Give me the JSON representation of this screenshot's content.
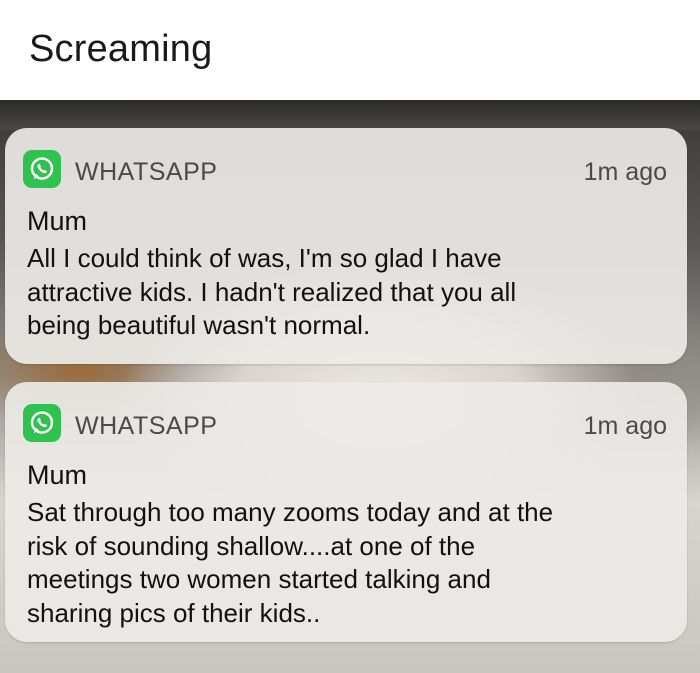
{
  "caption": "Screaming",
  "notifications": [
    {
      "app": "WHATSAPP",
      "time": "1m ago",
      "sender": "Mum",
      "lines": [
        "All I could think of was, I'm so glad I have",
        "attractive kids. I hadn't realized that you all",
        "being beautiful wasn't normal."
      ]
    },
    {
      "app": "WHATSAPP",
      "time": "1m ago",
      "sender": "Mum",
      "lines": [
        "Sat through too many zooms today and at the",
        "risk of sounding shallow....at one of the",
        "meetings two women started talking and",
        "sharing pics of their kids.."
      ]
    }
  ],
  "colors": {
    "whatsapp_green": "#2fc24f",
    "card": "#eceae7"
  },
  "icons": [
    "whatsapp-icon"
  ]
}
